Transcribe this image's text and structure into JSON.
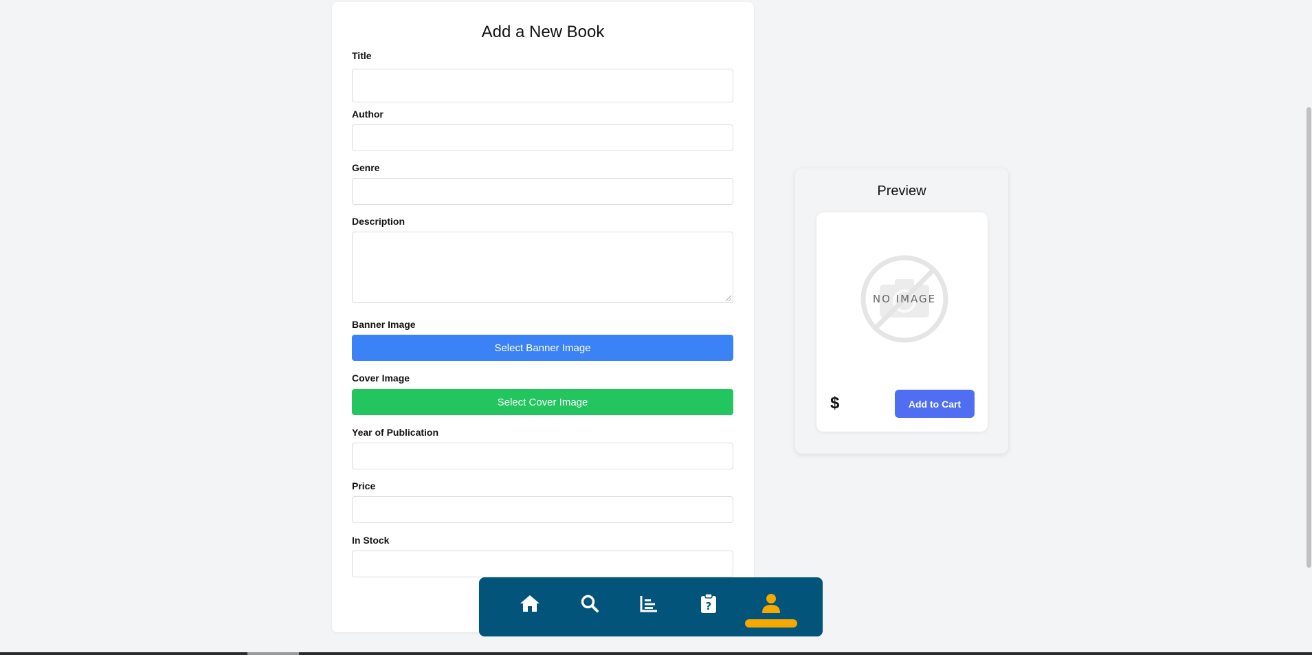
{
  "form": {
    "title": "Add a New Book",
    "fields": {
      "title_label": "Title",
      "author_label": "Author",
      "genre_label": "Genre",
      "description_label": "Description",
      "banner_label": "Banner Image",
      "cover_label": "Cover Image",
      "year_label": "Year of Publication",
      "price_label": "Price",
      "stock_label": "In Stock"
    },
    "banner_button": "Select Banner Image",
    "cover_button": "Select Cover Image",
    "values": {
      "title": "",
      "author": "",
      "genre": "",
      "description": "",
      "year": "",
      "price": "",
      "stock": ""
    }
  },
  "preview": {
    "title": "Preview",
    "placeholder_text": "NO IMAGE",
    "price": "$",
    "cart_button": "Add to Cart"
  },
  "nav": {
    "items": [
      "home-icon",
      "search-icon",
      "chart-icon",
      "clipboard-question-icon",
      "user-icon"
    ],
    "active": "user-icon"
  },
  "colors": {
    "banner_button": "#3b82f6",
    "cover_button": "#22c55e",
    "cart_button": "#4f6ef2",
    "nav_background": "#02547a",
    "nav_active": "#f5a800"
  }
}
